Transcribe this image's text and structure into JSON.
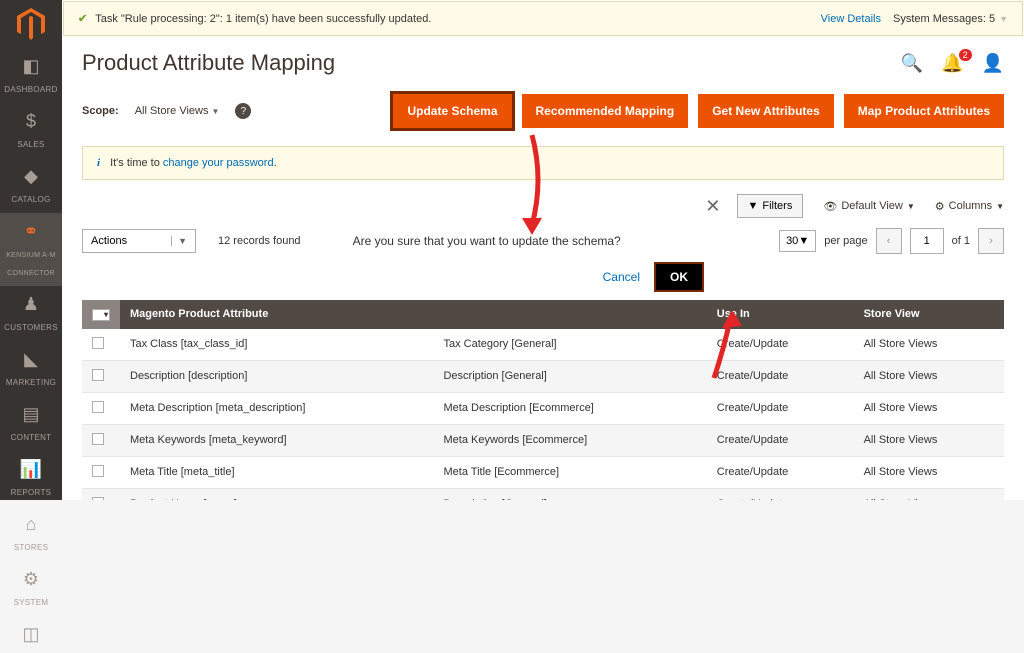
{
  "sysmsg": {
    "text": "Task \"Rule processing: 2\": 1 item(s) have been successfully updated.",
    "view_details": "View Details",
    "system_messages": "System Messages: 5"
  },
  "page_title": "Product Attribute Mapping",
  "header": {
    "notif_count": "2"
  },
  "scope": {
    "label": "Scope:",
    "value": "All Store Views"
  },
  "buttons": {
    "update_schema": "Update Schema",
    "recommended": "Recommended Mapping",
    "get_new": "Get New Attributes",
    "map_product": "Map Product Attributes"
  },
  "banner": {
    "prefix": "It's time to ",
    "link": "change your password",
    "suffix": "."
  },
  "modal": {
    "prompt": "Are you sure that you want to update the schema?",
    "cancel": "Cancel",
    "ok": "OK"
  },
  "toolbar": {
    "actions": "Actions",
    "records_found": "12 records found",
    "filters": "Filters",
    "default_view": "Default View",
    "columns": "Columns",
    "per_page_value": "30",
    "per_page_label": "per page",
    "page": "1",
    "of": "of 1"
  },
  "columns": {
    "c1": "Magento Product Attribute",
    "c2": "",
    "c3": "Use In",
    "c4": "Store View"
  },
  "rows": [
    {
      "c1": "Tax Class [tax_class_id]",
      "c2": "Tax Category [General]",
      "c3": "Create/Update",
      "c4": "All Store Views"
    },
    {
      "c1": "Description [description]",
      "c2": "Description [General]",
      "c3": "Create/Update",
      "c4": "All Store Views"
    },
    {
      "c1": "Meta Description [meta_description]",
      "c2": "Meta Description [Ecommerce]",
      "c3": "Create/Update",
      "c4": "All Store Views"
    },
    {
      "c1": "Meta Keywords [meta_keyword]",
      "c2": "Meta Keywords [Ecommerce]",
      "c3": "Create/Update",
      "c4": "All Store Views"
    },
    {
      "c1": "Meta Title [meta_title]",
      "c2": "Meta Title [Ecommerce]",
      "c3": "Create/Update",
      "c4": "All Store Views"
    },
    {
      "c1": "Product Name [name]",
      "c2": "Description [General]",
      "c3": "Create/Update",
      "c4": "All Store Views"
    }
  ],
  "nav": [
    {
      "label": "DASHBOARD"
    },
    {
      "label": "SALES"
    },
    {
      "label": "CATALOG"
    },
    {
      "label": "KENSIUM A-M CONNECTOR"
    },
    {
      "label": "CUSTOMERS"
    },
    {
      "label": "MARKETING"
    },
    {
      "label": "CONTENT"
    },
    {
      "label": "REPORTS"
    },
    {
      "label": "STORES"
    },
    {
      "label": "SYSTEM"
    }
  ]
}
